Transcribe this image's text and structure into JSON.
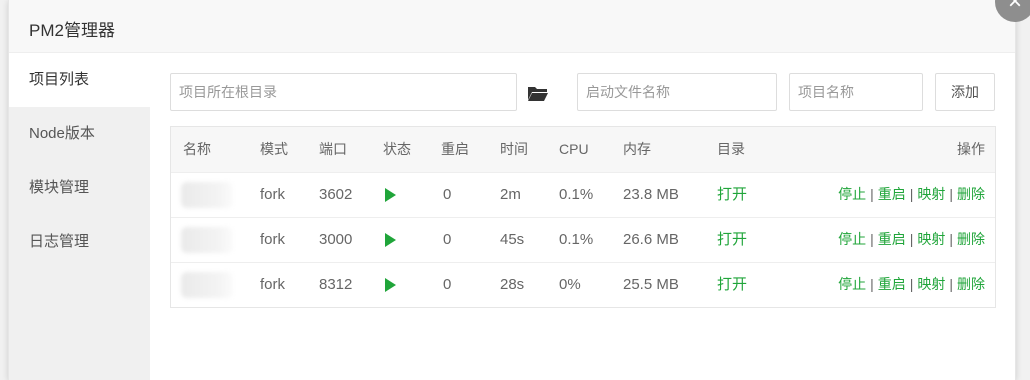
{
  "dialog": {
    "title": "PM2管理器",
    "close_symbol": "×"
  },
  "sidebar": {
    "items": [
      {
        "label": "项目列表",
        "active": true
      },
      {
        "label": "Node版本"
      },
      {
        "label": "模块管理"
      },
      {
        "label": "日志管理"
      }
    ]
  },
  "form": {
    "root_dir_placeholder": "项目所在根目录",
    "start_file_placeholder": "启动文件名称",
    "project_name_placeholder": "项目名称",
    "add_label": "添加"
  },
  "table": {
    "headers": {
      "name": "名称",
      "mode": "模式",
      "port": "端口",
      "status": "状态",
      "restart": "重启",
      "time": "时间",
      "cpu": "CPU",
      "memory": "内存",
      "dir": "目录",
      "ops": "操作"
    },
    "rows": [
      {
        "mode": "fork",
        "port": "3602",
        "restart": "0",
        "time": "2m",
        "cpu": "0.1%",
        "memory": "23.8 MB",
        "dir": "打开"
      },
      {
        "mode": "fork",
        "port": "3000",
        "restart": "0",
        "time": "45s",
        "cpu": "0.1%",
        "memory": "26.6 MB",
        "dir": "打开"
      },
      {
        "mode": "fork",
        "port": "8312",
        "restart": "0",
        "time": "28s",
        "cpu": "0%",
        "memory": "25.5 MB",
        "dir": "打开"
      }
    ],
    "ops": {
      "stop": "停止",
      "restart": "重启",
      "map": "映射",
      "delete": "删除",
      "separator": "|"
    }
  },
  "colors": {
    "accent": "#20a53a",
    "sidebar_bg": "#f0f0f0",
    "header_bg": "#f8f8f8"
  },
  "icons": {
    "folder": "folder-icon",
    "status": "play-icon",
    "close": "close-icon"
  }
}
